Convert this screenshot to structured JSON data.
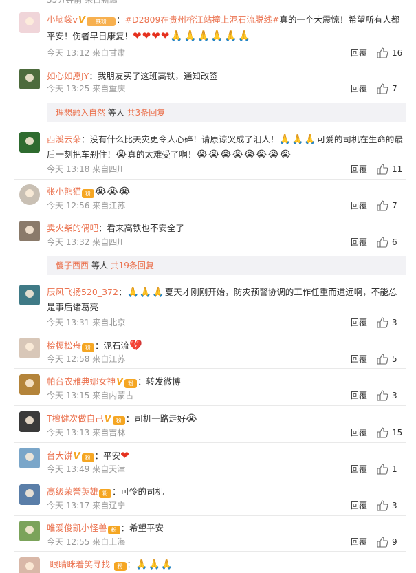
{
  "top_partial": {
    "meta": "35分钟前 来自新疆"
  },
  "comments": [
    {
      "user": "小脑袋v",
      "vip": "V",
      "badge": "铁粉",
      "text_before": "：",
      "topic": "#D2809在贵州榕江站撞上泥石流脱线#",
      "text": "真的一个大震惊！希望所有人都平安！伤者早日康复！",
      "emoji": "❤❤❤❤🙏🙏🙏🙏🙏🙏",
      "time": "今天 13:12 来自甘肃",
      "reply": "回覆",
      "likes": "16",
      "avatar_color": "#f0d5d9"
    },
    {
      "user": "如心如愿JY",
      "text": "：我朋友买了这班高铁，通知改签",
      "time": "今天 13:25 来自重庆",
      "reply": "回覆",
      "likes": "7",
      "avatar_color": "#4d6b3c"
    },
    {
      "user": "西溪云朵",
      "text": "：没有什么比天灾更令人心碎！请原谅哭成了泪人！",
      "emoji": "🙏🙏🙏",
      "text2": "可爱的司机在生命的最后一刻把车刹住！",
      "emoji2": "😭",
      "text3": "真的太难受了啊！",
      "emoji3": "😭😭😭😭😭😭😭😭",
      "time": "今天 13:18 来自四川",
      "reply": "回覆",
      "likes": "11",
      "avatar_color": "#2e6b2f"
    },
    {
      "user": "张小熊猫",
      "emoji": "😭😭😭",
      "time": "今天 12:56 来自江苏",
      "reply": "回覆",
      "likes": "7",
      "avatar_color": "#c9c0b4"
    },
    {
      "user": "卖火柴的偶吧",
      "text": "：看来高铁也不安全了",
      "time": "今天 13:32 来自四川",
      "reply": "回覆",
      "likes": "6",
      "avatar_color": "#8a7a6a"
    },
    {
      "user": "辰风飞扬520_372",
      "emoji": "🙏🙏🙏",
      "text": "夏天才刚刚开始，防灾预警协调的工作任重而道远啊，不能总是事后诸葛亮",
      "time": "今天 13:31 来自北京",
      "reply": "回覆",
      "likes": "3",
      "avatar_color": "#3f7a86"
    },
    {
      "user": "桧榎松舟",
      "text": "：泥石流",
      "emoji": "💔",
      "time": "今天 12:58 来自江苏",
      "reply": "回覆",
      "likes": "5",
      "avatar_color": "#d8c7b8"
    },
    {
      "user": "帕台农雅典娜女神",
      "vip": "V",
      "text": "：转发微博",
      "time": "今天 13:15 来自内蒙古",
      "reply": "回覆",
      "likes": "3",
      "avatar_color": "#b4843a"
    },
    {
      "user": "T檀健次做自己",
      "vip": "V",
      "text": "：司机一路走好",
      "emoji": "😭",
      "time": "今天 13:13 来自吉林",
      "reply": "回覆",
      "likes": "15",
      "avatar_color": "#3a3a3a"
    },
    {
      "user": "台大饼",
      "vip": "V",
      "text": "：平安",
      "emoji": "❤",
      "time": "今天 13:49 来自天津",
      "reply": "回覆",
      "likes": "1",
      "avatar_color": "#7aa6c9"
    },
    {
      "user": "高级荣誉英雄",
      "text": "：可怜的司机",
      "time": "今天 13:17 来自辽宁",
      "reply": "回覆",
      "likes": "3",
      "avatar_color": "#5a7ea8"
    },
    {
      "user": "唯爱俊凯小怪兽",
      "text": "：希望平安",
      "time": "今天 12:55 来自上海",
      "reply": "回覆",
      "likes": "9",
      "avatar_color": "#7ba35a"
    },
    {
      "user": "-眼睛眯着笑寻找-",
      "emoji": "🙏🙏🙏",
      "avatar_color": "#d9b8a8"
    }
  ],
  "sub_replies": [
    {
      "user": "理想融入自然",
      "mid": " 等人 ",
      "count": "共3条回复"
    },
    {
      "user": "傻子西西",
      "mid": " 等人 ",
      "count": "共19条回复"
    }
  ],
  "colors": {
    "link": "#eb7350",
    "meta": "#999999",
    "sub_bg": "#f2f2f5",
    "divider": "#e9e9e9"
  },
  "icons": {
    "like": "thumb-up-icon",
    "vip": "vip-icon",
    "fan_badge": "fan-badge-icon"
  }
}
